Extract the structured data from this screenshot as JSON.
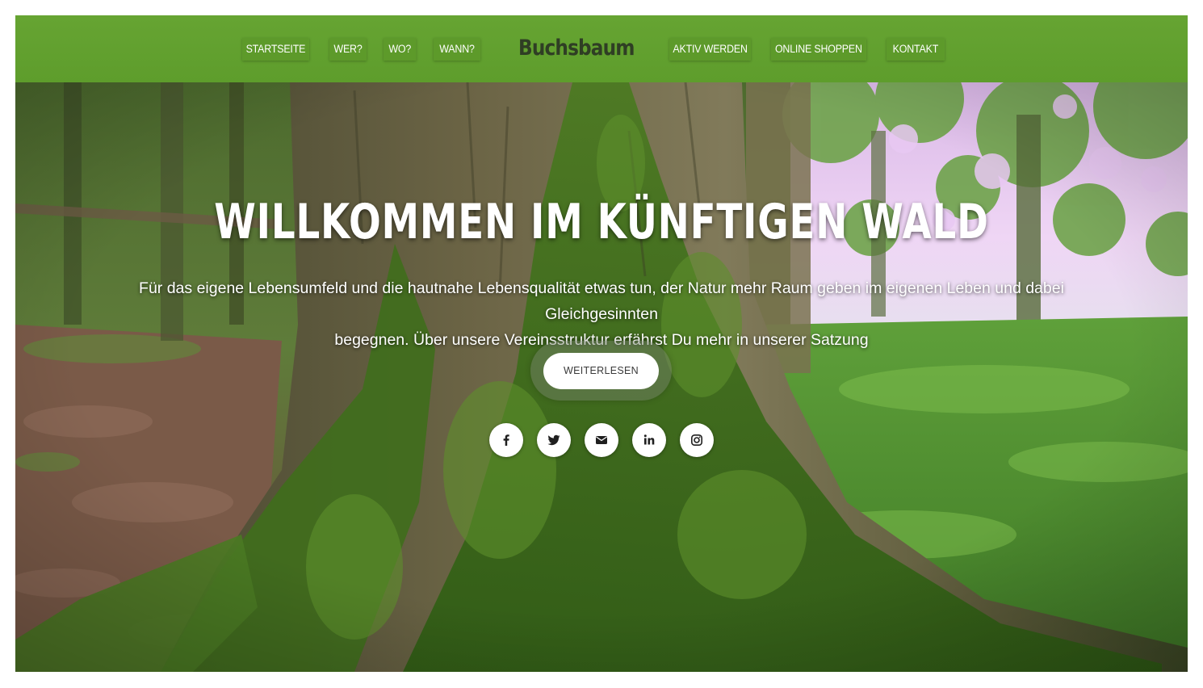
{
  "nav": {
    "items_left": [
      {
        "label": "STARTSEITE"
      },
      {
        "label": "WER?"
      },
      {
        "label": "WO?"
      },
      {
        "label": "WANN?"
      }
    ],
    "brand": "Buchsbaum",
    "items_right": [
      {
        "label": "AKTIV WERDEN"
      },
      {
        "label": "ONLINE SHOPPEN"
      },
      {
        "label": "KONTAKT"
      }
    ]
  },
  "hero": {
    "title": "WILLKOMMEN IM KÜNFTIGEN WALD",
    "text_line1": "Für das eigene Lebensumfeld und die hautnahe Lebensqualität etwas tun, der Natur mehr Raum geben im eigenen Leben und dabei Gleichgesinnten",
    "text_line2": "begegnen. Über unsere Vereinsstruktur erfährst Du mehr in unserer Satzung",
    "button_label": "WEITERLESEN"
  },
  "social": [
    {
      "icon": "facebook-icon"
    },
    {
      "icon": "twitter-icon"
    },
    {
      "icon": "envelope-icon"
    },
    {
      "icon": "linkedin-icon"
    },
    {
      "icon": "instagram-icon"
    }
  ],
  "colors": {
    "nav_green": "#62a02f",
    "brand_text": "#2f3e24",
    "moss": "#3f7a1e",
    "sky_lilac": "#e9ccf2"
  }
}
